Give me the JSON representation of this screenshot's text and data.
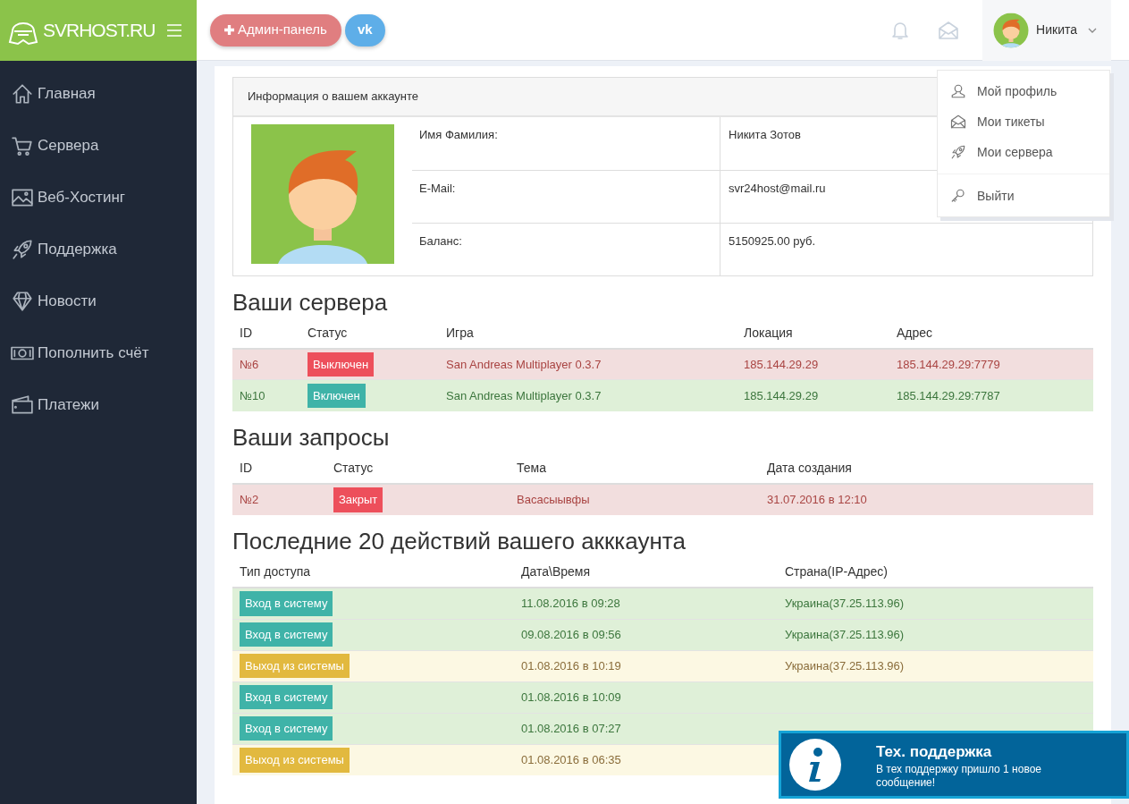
{
  "brand": {
    "logo": "**SVR**HOST.RU"
  },
  "header_buttons": [
    {
      "kind": "admin",
      "label": "Админ-панель"
    },
    {
      "kind": "vk",
      "label": "vk"
    }
  ],
  "user": {
    "name": "Никита"
  },
  "user_menu": [
    {
      "label": "Мой профиль",
      "divider_before": false
    },
    {
      "label": "Мои тикеты",
      "divider_before": false
    },
    {
      "label": "Мои сервера",
      "divider_before": false
    },
    {
      "label": "Выйти",
      "divider_before": true
    }
  ],
  "sidebar": {
    "items": [
      {
        "label": "Главная"
      },
      {
        "label": "Сервера"
      },
      {
        "label": "Веб-Хостинг"
      },
      {
        "label": "Поддержка"
      },
      {
        "label": "Новости"
      },
      {
        "label": "Пополнить счёт"
      },
      {
        "label": "Платежи"
      }
    ]
  },
  "account": {
    "title": "Информация о вашем аккаунте",
    "fields": [
      {
        "label": "Имя Фамилия:",
        "value": "Никита Зотов"
      },
      {
        "label": "E-Mail:",
        "value": "svr24host@mail.ru"
      },
      {
        "label": "Баланс:",
        "value": "5150925.00 руб."
      }
    ]
  },
  "servers": {
    "title": "Ваши сервера",
    "columns": [
      "ID",
      "Статус",
      "Игра",
      "Локация",
      "Адрес"
    ],
    "rows": [
      {
        "kind": "danger",
        "cells": [
          "№6",
          "Выключен",
          "San Andreas Multiplayer 0.3.7",
          "185.144.29.29",
          "185.144.29.29:7779"
        ]
      },
      {
        "kind": "success",
        "cells": [
          "№10",
          "Включен",
          "San Andreas Multiplayer 0.3.7",
          "185.144.29.29",
          "185.144.29.29:7787"
        ]
      }
    ]
  },
  "requests": {
    "title": "Ваши запросы",
    "columns": [
      "ID",
      "Статус",
      "Тема",
      "Дата создания"
    ],
    "rows": [
      {
        "kind": "danger",
        "cells": [
          "№2",
          "Закрыт",
          "Васасыывфы",
          "31.07.2016 в 12:10"
        ]
      }
    ]
  },
  "activity": {
    "title": "Последние 20 действий вашего акккаунта",
    "columns": [
      "Тип доступа",
      "Дата\\Время",
      "Страна(IP-Адрес)"
    ],
    "rows": [
      {
        "kind": "success",
        "access": "Вход в систему",
        "time": "11.08.2016 в 09:28",
        "country": "Украина(37.25.113.96)"
      },
      {
        "kind": "success",
        "access": "Вход в систему",
        "time": "09.08.2016 в 09:56",
        "country": "Украина(37.25.113.96)"
      },
      {
        "kind": "warning",
        "access": "Выход из системы",
        "time": "01.08.2016 в 10:19",
        "country": "Украина(37.25.113.96)"
      },
      {
        "kind": "success",
        "access": "Вход в систему",
        "time": "01.08.2016 в 10:09"
      },
      {
        "kind": "success",
        "access": "Вход в систему",
        "time": "01.08.2016 в 07:27"
      },
      {
        "kind": "warning",
        "access": "Выход из системы",
        "time": "01.08.2016 в 06:35"
      }
    ]
  },
  "toast": {
    "title": "Тех. поддержка",
    "message": "В тех поддержку пришло 1 новое сообщение!"
  }
}
